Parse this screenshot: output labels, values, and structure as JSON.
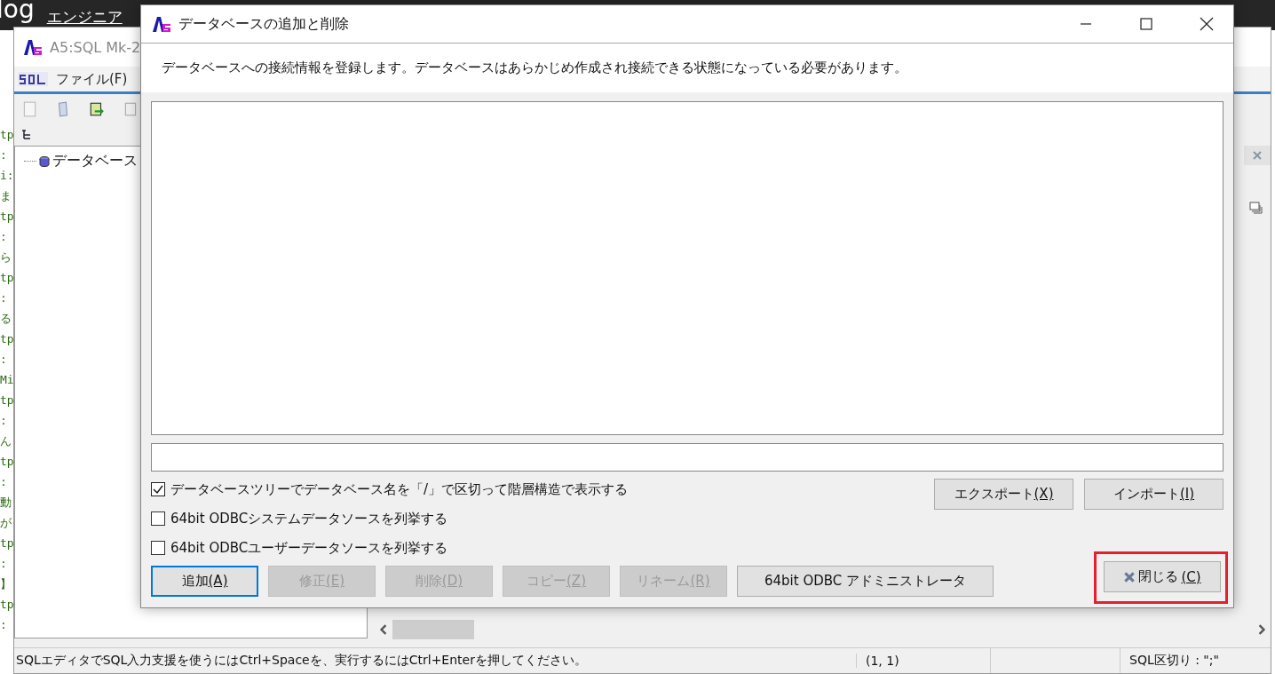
{
  "browser": {
    "logo": "log",
    "link": "エンジニア"
  },
  "code_strip": [
    "tp",
    ":",
    "i:",
    "ま",
    "tp",
    ":",
    "ら",
    "tp",
    ":",
    "る",
    "tp",
    ":",
    "Mi",
    "tp",
    ":",
    "ん",
    "tp",
    ":",
    "動",
    "が",
    "tp",
    ":",
    "】",
    "tp",
    ":"
  ],
  "app_window": {
    "title": "A5:SQL Mk-2",
    "menu": [
      "ファイル(F)"
    ],
    "tree": [
      {
        "label": "データベース"
      }
    ],
    "status_bar": {
      "message": "SQLエディタでSQL入力支援を使うにはCtrl+Spaceを、実行するにはCtrl+Enterを押してください。",
      "position": "(1, 1)",
      "delimiter": "SQL区切り : \";\""
    }
  },
  "dialog": {
    "title": "データベースの追加と削除",
    "description": "データベースへの接続情報を登録します。データベースはあらかじめ作成され接続できる状態になっている必要があります。",
    "checkboxes": [
      {
        "label": "データベースツリーでデータベース名を「/」で区切って階層構造で表示する",
        "checked": true
      },
      {
        "label": "64bit ODBCシステムデータソースを列挙する",
        "checked": false
      },
      {
        "label": "64bit ODBCユーザーデータソースを列挙する",
        "checked": false
      }
    ],
    "side_buttons": [
      {
        "label": "エクスポート",
        "accel": "(X)"
      },
      {
        "label": "インポート",
        "accel": "(I)"
      }
    ],
    "buttons": [
      {
        "label": "追加",
        "accel": "(A)",
        "disabled": false,
        "default": true
      },
      {
        "label": "修正",
        "accel": "(E)",
        "disabled": true,
        "default": false
      },
      {
        "label": "削除",
        "accel": "(D)",
        "disabled": true,
        "default": false
      },
      {
        "label": "コピー",
        "accel": "(Z)",
        "disabled": true,
        "default": false
      },
      {
        "label": "リネーム",
        "accel": "(R)",
        "disabled": true,
        "default": false
      },
      {
        "label": "64bit ODBC アドミニストレータ",
        "disabled": false,
        "default": false
      }
    ],
    "close_button": {
      "label": "閉じる",
      "accel": "(C)"
    }
  }
}
